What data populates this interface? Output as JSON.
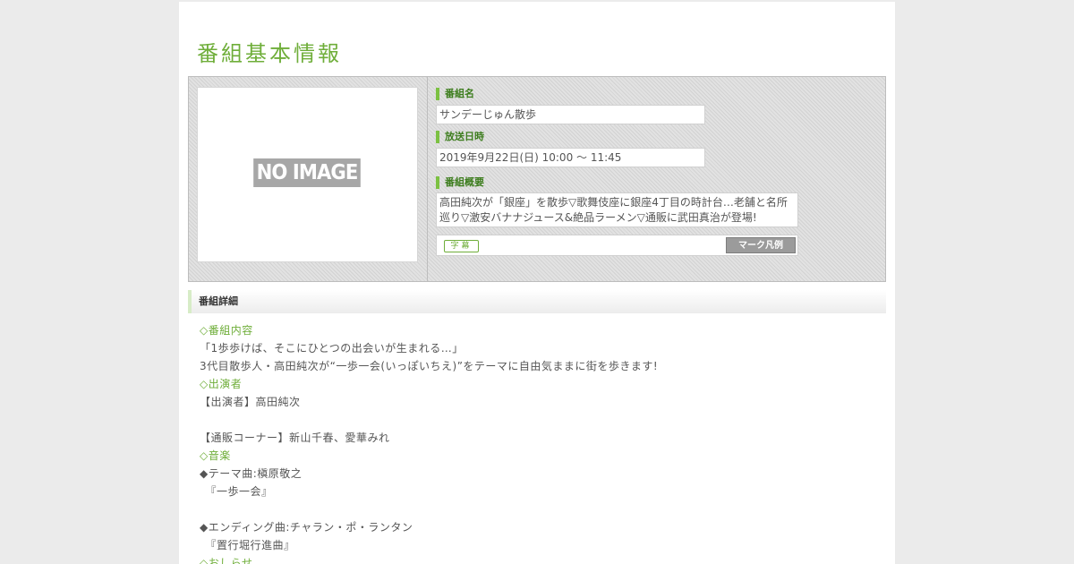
{
  "page": {
    "title": "番組基本情報"
  },
  "thumbnail": {
    "placeholder_text": "NO IMAGE"
  },
  "program": {
    "name_label": "番組名",
    "name": "サンデーじゅん散歩",
    "airtime_label": "放送日時",
    "airtime": "2019年9月22日(日) 10:00 ～ 11:45",
    "summary_label": "番組概要",
    "summary": "高田純次が「銀座」を散歩▽歌舞伎座に銀座4丁目の時計台…老舗と名所巡り▽激安バナナジュース&絶品ラーメン▽通販に武田真治が登場!",
    "caption_badge": "字幕",
    "mark_legend_button": "マーク凡例"
  },
  "details": {
    "header": "番組詳細",
    "lines": [
      {
        "text": "◇番組内容",
        "heading": true
      },
      {
        "text": "「1歩歩けば、そこにひとつの出会いが生まれる…」",
        "heading": false
      },
      {
        "text": "3代目散歩人・高田純次が“一歩一会(いっぽいちえ)”をテーマに自由気ままに街を歩きます!",
        "heading": false
      },
      {
        "text": "◇出演者",
        "heading": true
      },
      {
        "text": "【出演者】高田純次",
        "heading": false
      },
      {
        "text": "",
        "heading": false
      },
      {
        "text": "【通販コーナー】新山千春、愛華みれ",
        "heading": false
      },
      {
        "text": "◇音楽",
        "heading": true
      },
      {
        "text": "◆テーマ曲:槇原敬之",
        "heading": false
      },
      {
        "text": "　『一歩一会』",
        "heading": false
      },
      {
        "text": "",
        "heading": false
      },
      {
        "text": "◆エンディング曲:チャラン・ポ・ランタン",
        "heading": false
      },
      {
        "text": "　『置行堀行進曲』",
        "heading": false
      },
      {
        "text": "◇おしらせ",
        "heading": true
      }
    ]
  },
  "colors": {
    "accent_green": "#6fae3a",
    "label_green": "#3d7d1e",
    "background_gray": "#ebebeb"
  }
}
